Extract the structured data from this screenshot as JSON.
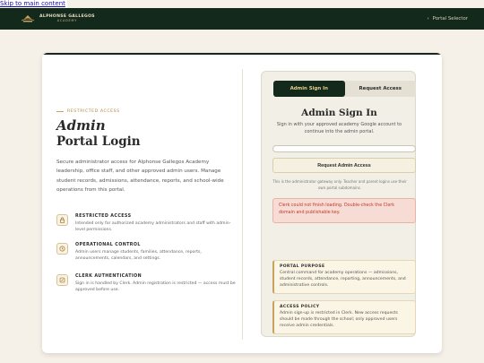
{
  "skip_link": "Skip to main content",
  "header": {
    "brand_name": "ALPHONSE GALLEGOS",
    "brand_sub": "ACADEMY",
    "portal_selector": "Portal Selector"
  },
  "left": {
    "eyebrow": "RESTRICTED ACCESS",
    "title_line1": "Admin",
    "title_line2": "Portal Login",
    "lead": "Secure administrator access for Alphonse Gallegos Academy leadership, office staff, and other approved admin users. Manage student records, admissions, attendance, reports, and school-wide operations from this portal.",
    "features": [
      {
        "icon": "lock-icon",
        "title": "RESTRICTED ACCESS",
        "desc": "Intended only for authorized academy administrators and staff with admin-level permissions."
      },
      {
        "icon": "clock-icon",
        "title": "OPERATIONAL CONTROL",
        "desc": "Admin users manage students, families, attendance, reports, announcements, calendars, and settings."
      },
      {
        "icon": "edit-icon",
        "title": "CLERK AUTHENTICATION",
        "desc": "Sign in is handled by Clerk. Admin registration is restricted — access must be approved before use."
      }
    ]
  },
  "panel": {
    "tab_signin": "Admin Sign In",
    "tab_request": "Request Access",
    "title": "Admin Sign In",
    "subtitle": "Sign in with your approved academy Google account to continue into the admin portal.",
    "input_placeholder": "",
    "request_button": "Request Admin Access",
    "note": "This is the administrator gateway only. Teacher and parent logins use their own portal subdomains.",
    "error": "Clerk could not finish loading. Double-check the Clerk domain and publishable key.",
    "purpose_title": "PORTAL PURPOSE",
    "purpose_desc": "Central command for academy operations — admissions, student records, attendance, reporting, announcements, and administrative controls.",
    "policy_title": "ACCESS POLICY",
    "policy_desc": "Admin sign-up is restricted in Clerk. New access requests should be made through the school; only approved users receive admin credentials."
  }
}
